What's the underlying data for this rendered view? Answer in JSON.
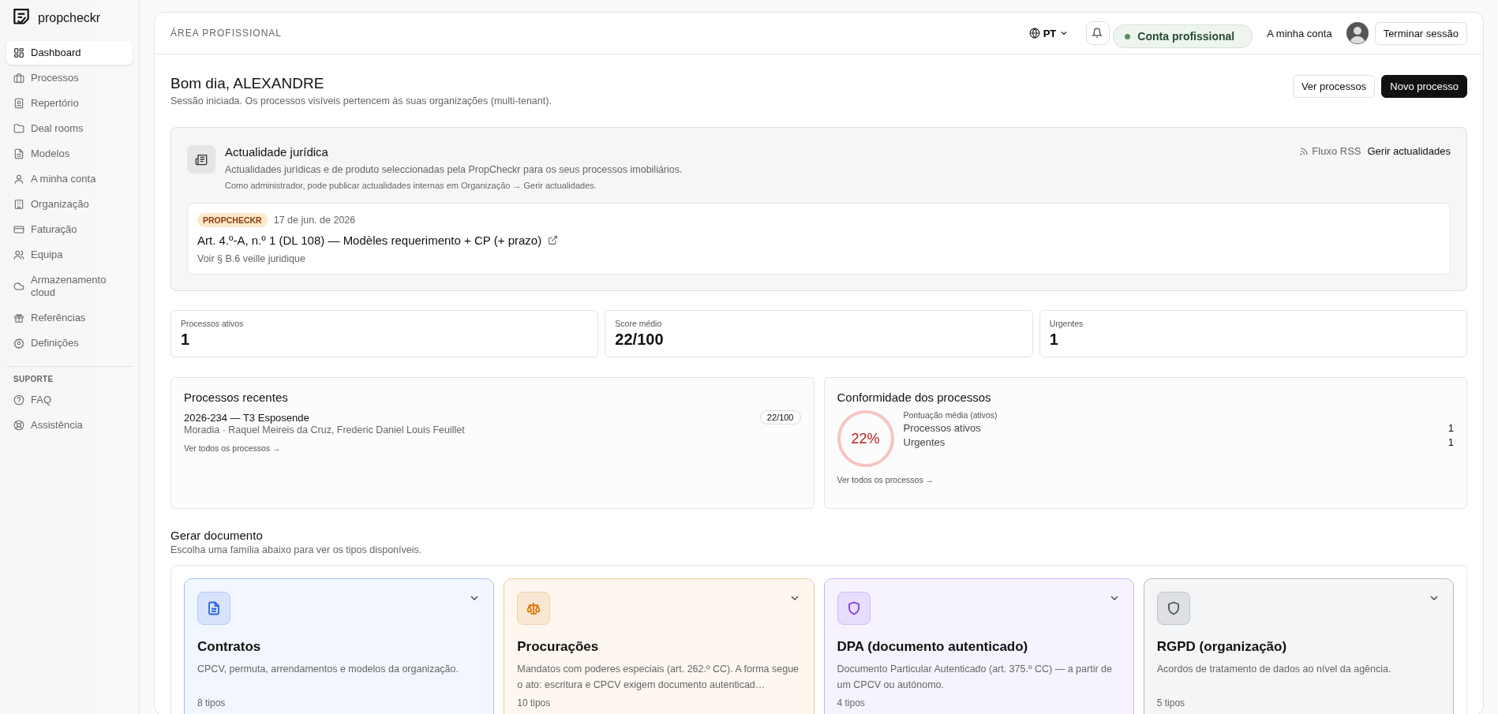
{
  "sidebar": {
    "logo": "propcheckr",
    "items": [
      {
        "label": "Dashboard",
        "selected": true
      },
      {
        "label": "Processos",
        "selected": false
      },
      {
        "label": "Repertório",
        "selected": false
      },
      {
        "label": "Deal rooms",
        "selected": false
      },
      {
        "label": "Modelos",
        "selected": false
      },
      {
        "label": "A minha conta",
        "selected": false
      },
      {
        "label": "Organização",
        "selected": false
      },
      {
        "label": "Faturação",
        "selected": false
      },
      {
        "label": "Equipa",
        "selected": false
      },
      {
        "label": "Armazenamento cloud",
        "selected": false
      },
      {
        "label": "Referências",
        "selected": false
      },
      {
        "label": "Definições",
        "selected": false
      }
    ],
    "support_heading": "SUPORTE",
    "support_items": [
      {
        "label": "FAQ",
        "selected": false
      },
      {
        "label": "Assistência",
        "selected": false
      }
    ]
  },
  "header": {
    "section": "ÁREA PROFISSIONAL",
    "language": "PT",
    "account_badge": "Conta profissional",
    "account_link": "A minha conta",
    "logout": "Terminar sessão"
  },
  "greeting": {
    "title": "Bom dia, ALEXANDRE",
    "subtitle": "Sessão iniciada. Os processos visíveis pertencem às suas organizações (multi-tenant).",
    "buttons": [
      {
        "label": "Ver processos",
        "kind": "secondary"
      },
      {
        "label": "Novo processo",
        "kind": "primary"
      }
    ]
  },
  "news": {
    "title": "Actualidade jurídica",
    "description": "Actualidades jurídicas e de produto seleccionadas pela PropCheckr para os seus processos imobiliários.",
    "admin_note": "Como administrador, pode publicar actualidades internas em Organização → Gerir actualidades.",
    "rss": "Fluxo RSS",
    "manage": "Gerir actualidades",
    "items": [
      {
        "source": "PROPCHECKR",
        "date": "17 de jun. de 2026",
        "title": "Art. 4.º-A, n.º 1 (DL 108) — Modèles requerimento + CP (+ prazo)",
        "reference": "Voir § B.6 veille juridique"
      }
    ]
  },
  "stats": [
    {
      "label": "Processos ativos",
      "value": "1"
    },
    {
      "label": "Score médio",
      "value": "22/100"
    },
    {
      "label": "Urgentes",
      "value": "1"
    }
  ],
  "recent": {
    "title": "Processos recentes",
    "items": [
      {
        "name": "2026-234 — T3 Esposende",
        "detail": "Moradia · Raquel Meireis da Cruz, Frederic Daniel Louis Feuillet",
        "score": "22/100"
      }
    ],
    "link": "Ver todos os processos →"
  },
  "compliance": {
    "title": "Conformidade dos processos",
    "score": "22%",
    "caption": "Pontuação média (ativos)",
    "rows": [
      {
        "label": "Processos ativos",
        "value": "1"
      },
      {
        "label": "Urgentes",
        "value": "1"
      }
    ],
    "link": "Ver todos os processos →"
  },
  "documents": {
    "title": "Gerar documento",
    "subtitle": "Escolha uma família abaixo para ver os tipos disponíveis.",
    "families": [
      {
        "title": "Contratos",
        "description": "CPCV, permuta, arrendamentos e modelos da organização.",
        "count": "8 tipos",
        "color": "#2563eb"
      },
      {
        "title": "Procurações",
        "description": "Mandatos com poderes especiais (art. 262.º CC). A forma segue o ato: escritura e CPCV exigem documento autenticad…",
        "count": "10 tipos",
        "color": "#d97706"
      },
      {
        "title": "DPA (documento autenticado)",
        "description": "Documento Particular Autenticado (art. 375.º CC) — a partir de um CPCV ou autónomo.",
        "count": "4 tipos",
        "color": "#7c3aed"
      },
      {
        "title": "RGPD (organização)",
        "description": "Acordos de tratamento de dados ao nível da agência.",
        "count": "5 tipos",
        "color": "#4b5563"
      }
    ]
  }
}
